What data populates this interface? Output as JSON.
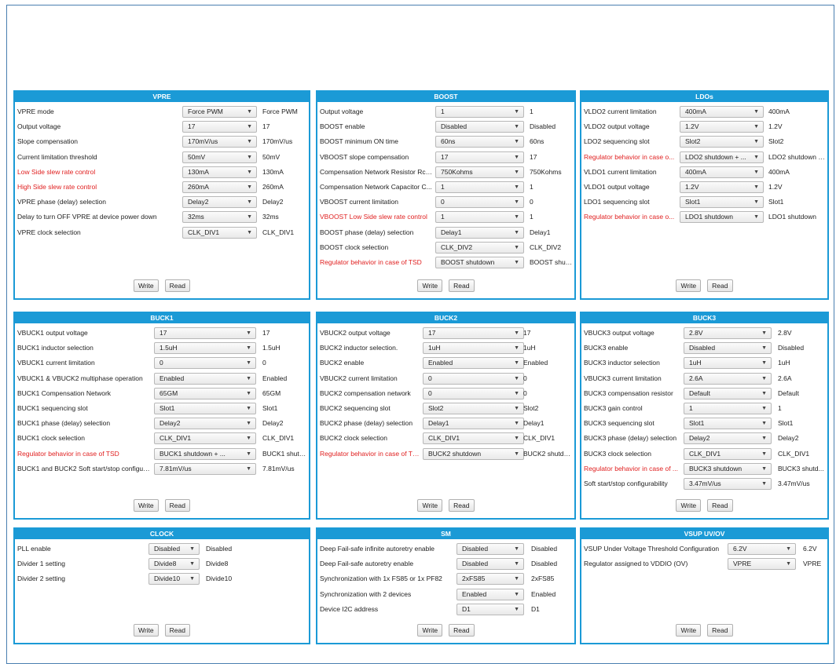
{
  "buttons": {
    "write": "Write",
    "read": "Read"
  },
  "panels": [
    {
      "id": "vpre",
      "title": "VPRE",
      "rows": [
        {
          "label": "VPRE mode",
          "value": "Force PWM",
          "display": "Force PWM"
        },
        {
          "label": "Output voltage",
          "value": "17",
          "display": "17"
        },
        {
          "label": "Slope compensation",
          "value": "170mV/us",
          "display": "170mV/us"
        },
        {
          "label": "Current limitation threshold",
          "value": "50mV",
          "display": "50mV"
        },
        {
          "label": "Low Side slew rate control",
          "value": "130mA",
          "display": "130mA",
          "red": true
        },
        {
          "label": "High Side slew rate control",
          "value": "260mA",
          "display": "260mA",
          "red": true
        },
        {
          "label": "VPRE phase (delay) selection",
          "value": "Delay2",
          "display": "Delay2"
        },
        {
          "label": "Delay to turn OFF VPRE at device power down",
          "value": "32ms",
          "display": "32ms"
        },
        {
          "label": "VPRE clock selection",
          "value": "CLK_DIV1",
          "display": "CLK_DIV1"
        }
      ]
    },
    {
      "id": "boost",
      "title": "BOOST",
      "rows": [
        {
          "label": "Output voltage",
          "value": "1",
          "display": "1"
        },
        {
          "label": "BOOST enable",
          "value": "Disabled",
          "display": "Disabled"
        },
        {
          "label": "BOOST minimum ON time",
          "value": "60ns",
          "display": "60ns"
        },
        {
          "label": "VBOOST slope compensation",
          "value": "17",
          "display": "17"
        },
        {
          "label": "Compensation Network Resistor Rco...",
          "value": "750Kohms",
          "display": "750Kohms"
        },
        {
          "label": "Compensation Network Capacitor C...",
          "value": "1",
          "display": "1"
        },
        {
          "label": "VBOOST current limitation",
          "value": "0",
          "display": "0"
        },
        {
          "label": "VBOOST Low Side slew rate control",
          "value": "1",
          "display": "1",
          "red": true
        },
        {
          "label": "BOOST phase (delay) selection",
          "value": "Delay1",
          "display": "Delay1"
        },
        {
          "label": "BOOST clock selection",
          "value": "CLK_DIV2",
          "display": "CLK_DIV2"
        },
        {
          "label": "Regulator behavior in case of TSD",
          "value": "BOOST shutdown",
          "display": "BOOST shut...",
          "red": true
        }
      ]
    },
    {
      "id": "ldos",
      "title": "LDOs",
      "rows": [
        {
          "label": "VLDO2 current limitation",
          "value": "400mA",
          "display": "400mA"
        },
        {
          "label": "VLDO2 output voltage",
          "value": "1.2V",
          "display": "1.2V"
        },
        {
          "label": "LDO2 sequencing slot",
          "value": "Slot2",
          "display": "Slot2"
        },
        {
          "label": "Regulator behavior in case o...",
          "value": "LDO2 shutdown + ...",
          "display": "LDO2 shutdown +...",
          "red": true
        },
        {
          "label": "VLDO1 current limitation",
          "value": "400mA",
          "display": "400mA"
        },
        {
          "label": "VLDO1 output voltage",
          "value": "1.2V",
          "display": "1.2V"
        },
        {
          "label": "LDO1 sequencing slot",
          "value": "Slot1",
          "display": "Slot1"
        },
        {
          "label": "Regulator behavior in case o...",
          "value": "LDO1 shutdown",
          "display": "LDO1 shutdown",
          "red": true
        }
      ]
    },
    {
      "id": "buck1",
      "title": "BUCK1",
      "rows": [
        {
          "label": "VBUCK1 output voltage",
          "value": "17",
          "display": "17"
        },
        {
          "label": "BUCK1 inductor selection",
          "value": "1.5uH",
          "display": "1.5uH"
        },
        {
          "label": "VBUCK1 current limitation",
          "value": "0",
          "display": "0"
        },
        {
          "label": "VBUCK1 & VBUCK2 multiphase operation",
          "value": "Enabled",
          "display": "Enabled"
        },
        {
          "label": "BUCK1 Compensation Network",
          "value": "65GM",
          "display": "65GM"
        },
        {
          "label": "BUCK1 sequencing slot",
          "value": "Slot1",
          "display": "Slot1"
        },
        {
          "label": "BUCK1 phase (delay) selection",
          "value": "Delay2",
          "display": "Delay2"
        },
        {
          "label": "BUCK1 clock selection",
          "value": "CLK_DIV1",
          "display": "CLK_DIV1"
        },
        {
          "label": "Regulator behavior in case of TSD",
          "value": "BUCK1 shutdown + ...",
          "display": "BUCK1 shutdown +...",
          "red": true
        },
        {
          "label": "BUCK1 and BUCK2 Soft start/stop configura...",
          "value": "7.81mV/us",
          "display": "7.81mV/us"
        }
      ]
    },
    {
      "id": "buck2",
      "title": "BUCK2",
      "rows": [
        {
          "label": "VBUCK2 output voltage",
          "value": "17",
          "display": "17"
        },
        {
          "label": "BUCK2 inductor selection.",
          "value": "1uH",
          "display": "1uH"
        },
        {
          "label": "BUCK2 enable",
          "value": "Enabled",
          "display": "Enabled"
        },
        {
          "label": "VBUCK2 current limitation",
          "value": "0",
          "display": "0"
        },
        {
          "label": "BUCK2 compensation network",
          "value": "0",
          "display": "0"
        },
        {
          "label": "BUCK2 sequencing slot",
          "value": "Slot2",
          "display": "Slot2"
        },
        {
          "label": "BUCK2 phase (delay) selection",
          "value": "Delay1",
          "display": "Delay1"
        },
        {
          "label": "BUCK2 clock selection",
          "value": "CLK_DIV1",
          "display": "CLK_DIV1"
        },
        {
          "label": "Regulator behavior in case of TSD",
          "value": "BUCK2 shutdown",
          "display": "BUCK2 shutdown",
          "red": true
        }
      ]
    },
    {
      "id": "buck3",
      "title": "BUCK3",
      "rows": [
        {
          "label": "VBUCK3 output voltage",
          "value": "2.8V",
          "display": "2.8V"
        },
        {
          "label": "BUCK3 enable",
          "value": "Disabled",
          "display": "Disabled"
        },
        {
          "label": "BUCK3 inductor selection",
          "value": "1uH",
          "display": "1uH"
        },
        {
          "label": "VBUCK3 current limitation",
          "value": "2.6A",
          "display": "2.6A"
        },
        {
          "label": "BUCK3 compensation resistor",
          "value": "Default",
          "display": "Default"
        },
        {
          "label": "BUCK3 gain control",
          "value": "1",
          "display": "1"
        },
        {
          "label": "BUCK3 sequencing slot",
          "value": "Slot1",
          "display": "Slot1"
        },
        {
          "label": "BUCK3 phase (delay) selection",
          "value": "Delay2",
          "display": "Delay2"
        },
        {
          "label": "BUCK3 clock selection",
          "value": "CLK_DIV1",
          "display": "CLK_DIV1"
        },
        {
          "label": "Regulator behavior in case of ...",
          "value": "BUCK3 shutdown",
          "display": "BUCK3 shutd...",
          "red": true
        },
        {
          "label": "Soft start/stop configurability",
          "value": "3.47mV/us",
          "display": "3.47mV/us"
        }
      ]
    },
    {
      "id": "clock",
      "title": "CLOCK",
      "rows": [
        {
          "label": "PLL enable",
          "value": "Disabled",
          "display": "Disabled"
        },
        {
          "label": "Divider 1 setting",
          "value": "Divide8",
          "display": "Divide8"
        },
        {
          "label": "Divider 2 setting",
          "value": "Divide10",
          "display": "Divide10"
        }
      ]
    },
    {
      "id": "sm",
      "title": "SM",
      "rows": [
        {
          "label": "Deep Fail-safe infinite autoretry enable",
          "value": "Disabled",
          "display": "Disabled"
        },
        {
          "label": "Deep Fail-safe autoretry enable",
          "value": "Disabled",
          "display": "Disabled"
        },
        {
          "label": "Synchronization with 1x FS85 or 1x PF82",
          "value": "2xFS85",
          "display": "2xFS85"
        },
        {
          "label": "Synchronization with 2 devices",
          "value": "Enabled",
          "display": "Enabled"
        },
        {
          "label": "Device I2C address",
          "value": "D1",
          "display": "D1"
        }
      ]
    },
    {
      "id": "vsup",
      "title": "VSUP UV/OV",
      "rows": [
        {
          "label": "VSUP Under Voltage Threshold Configuration",
          "value": "6.2V",
          "display": "6.2V"
        },
        {
          "label": "Regulator assigned to VDDIO (OV)",
          "value": "VPRE",
          "display": "VPRE"
        }
      ]
    }
  ]
}
